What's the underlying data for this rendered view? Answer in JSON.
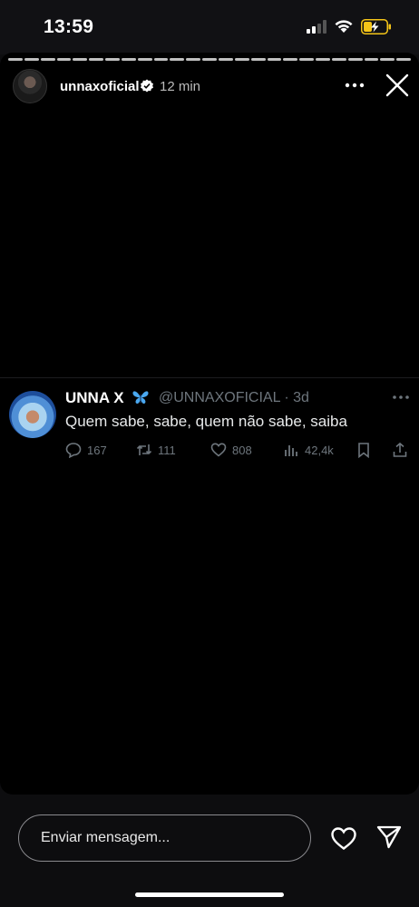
{
  "status_bar": {
    "time": "13:59"
  },
  "story": {
    "username": "unnaxoficial",
    "time_ago": "12 min",
    "progress_segments": 25
  },
  "tweet": {
    "display_name": "UNNA X",
    "handle": "@UNNAXOFICIAL · 3d",
    "text": "Quem sabe, sabe, quem não sabe, saiba",
    "replies": "167",
    "retweets": "111",
    "likes": "808",
    "views": "42,4k"
  },
  "bottom_bar": {
    "message_placeholder": "Enviar mensagem..."
  },
  "colors": {
    "background": "#000000",
    "muted_text": "#6e767d",
    "battery_accent": "#f5c518"
  }
}
